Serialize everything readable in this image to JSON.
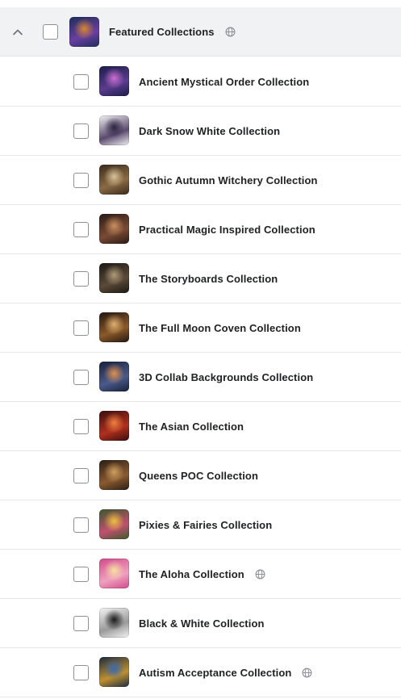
{
  "parent": {
    "label": "Featured Collections",
    "has_globe": true,
    "colors": [
      "#1d2d5c",
      "#6a3fa0",
      "#d9862f"
    ]
  },
  "items": [
    {
      "label": "Ancient Mystical Order Collection",
      "has_globe": false,
      "colors": [
        "#1a1c4a",
        "#5b3c8e",
        "#c96fd0"
      ]
    },
    {
      "label": "Dark Snow White Collection",
      "has_globe": false,
      "colors": [
        "#f2f2f4",
        "#5b4a6e",
        "#2c2440"
      ]
    },
    {
      "label": "Gothic Autumn Witchery Collection",
      "has_globe": false,
      "colors": [
        "#3a2a1c",
        "#8a6a44",
        "#d8c39a"
      ]
    },
    {
      "label": "Practical Magic Inspired Collection",
      "has_globe": false,
      "colors": [
        "#2a1a14",
        "#7a4a34",
        "#c99060"
      ]
    },
    {
      "label": "The Storyboards Collection",
      "has_globe": false,
      "colors": [
        "#1c1814",
        "#5a4a38",
        "#b09a78"
      ]
    },
    {
      "label": "The Full Moon Coven Collection",
      "has_globe": false,
      "colors": [
        "#241610",
        "#8a5a2a",
        "#e0b070"
      ]
    },
    {
      "label": "3D Collab Backgrounds Collection",
      "has_globe": false,
      "colors": [
        "#18203a",
        "#4a5a8a",
        "#e09050"
      ]
    },
    {
      "label": "The Asian Collection",
      "has_globe": false,
      "colors": [
        "#3a0e0e",
        "#b0301e",
        "#f08040"
      ]
    },
    {
      "label": "Queens POC Collection",
      "has_globe": false,
      "colors": [
        "#2a1e14",
        "#8a5a30",
        "#d0a060"
      ]
    },
    {
      "label": "Pixies & Fairies Collection",
      "has_globe": false,
      "colors": [
        "#3a5a2a",
        "#c05070",
        "#f0c040"
      ]
    },
    {
      "label": "The Aloha Collection",
      "has_globe": true,
      "colors": [
        "#d04a8a",
        "#f0a0c0",
        "#f6e0a0"
      ]
    },
    {
      "label": "Black & White Collection",
      "has_globe": false,
      "colors": [
        "#f4f4f4",
        "#9a9a9a",
        "#1a1a1a"
      ]
    },
    {
      "label": "Autism Acceptance Collection",
      "has_globe": true,
      "colors": [
        "#1a2a40",
        "#c09030",
        "#3a6ab0"
      ]
    }
  ]
}
